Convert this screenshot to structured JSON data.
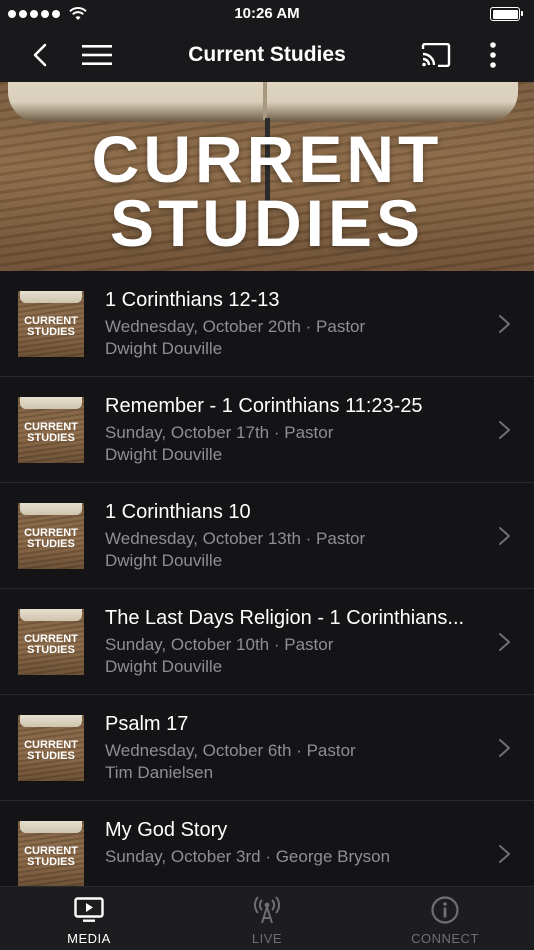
{
  "status_bar": {
    "time": "10:26 AM"
  },
  "nav": {
    "title": "Current Studies"
  },
  "hero": {
    "line1": "CURRENT",
    "line2": "STUDIES"
  },
  "thumbnail": {
    "line1": "CURRENT",
    "line2": "STUDIES"
  },
  "studies": [
    {
      "title": "1 Corinthians 12-13",
      "line1": "Wednesday, October 20th · Pastor",
      "line2": "Dwight Douville"
    },
    {
      "title": "Remember - 1 Corinthians 11:23-25",
      "line1": "Sunday, October 17th · Pastor",
      "line2": "Dwight Douville"
    },
    {
      "title": "1 Corinthians 10",
      "line1": "Wednesday, October 13th · Pastor",
      "line2": "Dwight Douville"
    },
    {
      "title": "The Last Days Religion - 1 Corinthians...",
      "line1": "Sunday, October 10th · Pastor",
      "line2": "Dwight Douville"
    },
    {
      "title": "Psalm 17",
      "line1": "Wednesday, October 6th · Pastor",
      "line2": "Tim Danielsen"
    },
    {
      "title": "My God Story",
      "line1": "Sunday, October 3rd · George Bryson",
      "line2": ""
    }
  ],
  "tabs": [
    {
      "label": "MEDIA",
      "icon": "tv-play-icon",
      "active": true
    },
    {
      "label": "LIVE",
      "icon": "broadcast-icon",
      "active": false
    },
    {
      "label": "CONNECT",
      "icon": "info-icon",
      "active": false
    }
  ],
  "colors": {
    "background": "#121214",
    "bar": "#19191b",
    "secondary_text": "#8e8e93",
    "inactive_tab": "#6f6f73"
  }
}
